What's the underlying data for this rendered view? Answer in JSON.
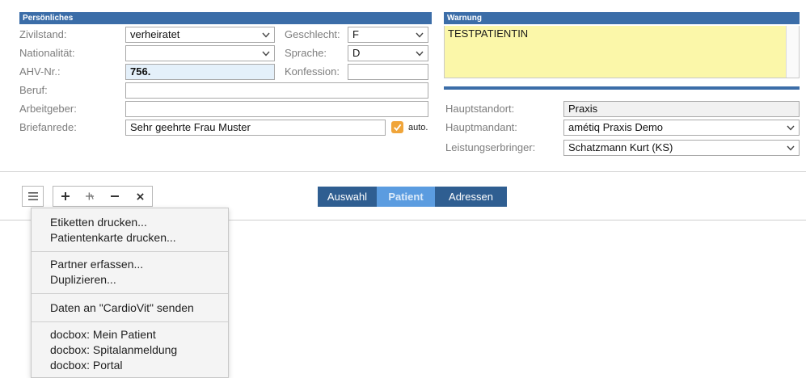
{
  "personal": {
    "header": "Persönliches",
    "civil_status_label": "Zivilstand:",
    "civil_status_value": "verheiratet",
    "gender_label": "Geschlecht:",
    "gender_value": "F",
    "nationality_label": "Nationalität:",
    "nationality_value": "",
    "language_label": "Sprache:",
    "language_value": "D",
    "ahv_label": "AHV-Nr.:",
    "ahv_value": "756.",
    "confession_label": "Konfession:",
    "confession_value": "",
    "profession_label": "Beruf:",
    "profession_value": "",
    "employer_label": "Arbeitgeber:",
    "employer_value": "",
    "salutation_label": "Briefanrede:",
    "salutation_value": "Sehr geehrte Frau Muster",
    "auto_label": "auto.",
    "auto_checked": true
  },
  "warning": {
    "header": "Warnung",
    "text": "TESTPATIENTIN"
  },
  "practice": {
    "main_location_label": "Hauptstandort:",
    "main_location_value": "Praxis",
    "main_client_label": "Hauptmandant:",
    "main_client_value": "amétiq Praxis Demo",
    "provider_label": "Leistungserbringer:",
    "provider_value": "Schatzmann Kurt (KS)"
  },
  "toolbar": {
    "menu_icon": "hamburger-icon",
    "add_icon": "plus-icon",
    "add_alt_icon": "plus-strike-icon",
    "remove_icon": "minus-icon",
    "delete_icon": "x-icon"
  },
  "tabs": [
    {
      "label": "Auswahl",
      "active": false
    },
    {
      "label": "Patient",
      "active": true
    },
    {
      "label": "Adressen",
      "active": false
    }
  ],
  "menu": {
    "groups": [
      [
        "Etiketten drucken...",
        "Patientenkarte drucken..."
      ],
      [
        "Partner erfassen...",
        "Duplizieren..."
      ],
      [
        "Daten an \"CardioVit\" senden"
      ],
      [
        "docbox: Mein Patient",
        "docbox: Spitalanmeldung",
        "docbox: Portal"
      ]
    ]
  },
  "colors": {
    "header_blue": "#3b6da8",
    "tab_dark": "#2f5e91",
    "tab_active": "#5b9ce0",
    "warning_yellow": "#fbf7a9",
    "checkbox_orange": "#f0a53a"
  }
}
